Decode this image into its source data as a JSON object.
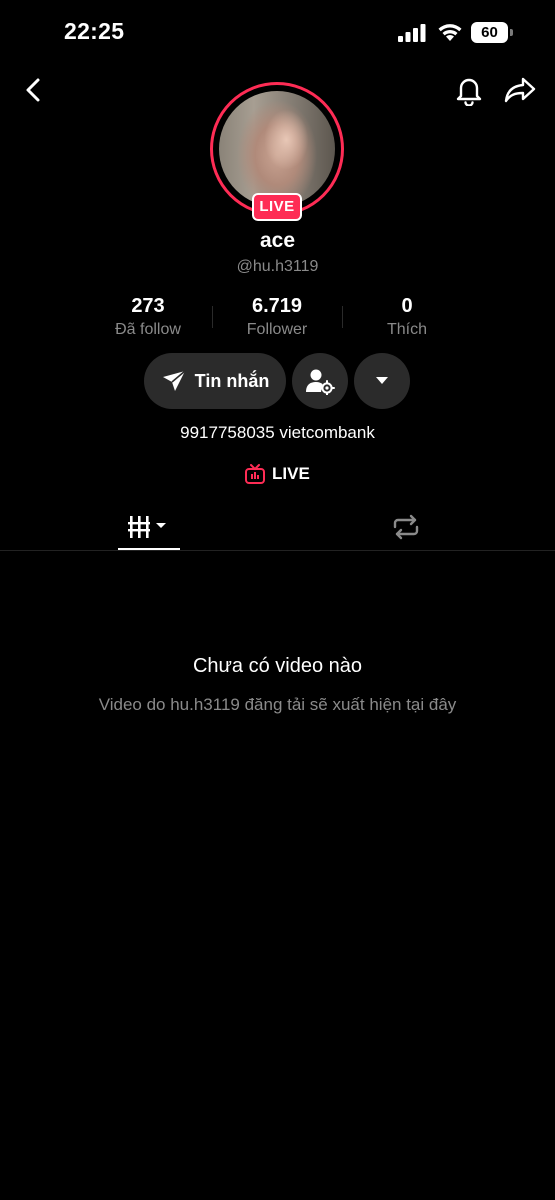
{
  "status_bar": {
    "time": "22:25",
    "battery": "60"
  },
  "profile": {
    "display_name": "ace",
    "username": "@hu.h3119",
    "live_badge": "LIVE",
    "bio": "9917758035 vietcombank",
    "live_link": "LIVE"
  },
  "stats": {
    "following": {
      "value": "273",
      "label": "Đã follow"
    },
    "followers": {
      "value": "6.719",
      "label": "Follower"
    },
    "likes": {
      "value": "0",
      "label": "Thích"
    }
  },
  "actions": {
    "message_label": "Tin nhắn"
  },
  "tabs": [
    "videos-grid-icon",
    "repost-icon"
  ],
  "empty_state": {
    "title": "Chưa có video nào",
    "subtitle": "Video do hu.h3119 đăng tải sẽ xuất hiện tại đây"
  },
  "colors": {
    "accent": "#fe2c55",
    "background": "#000000",
    "button": "#2b2b2b",
    "muted_text": "#8a8a8a"
  }
}
